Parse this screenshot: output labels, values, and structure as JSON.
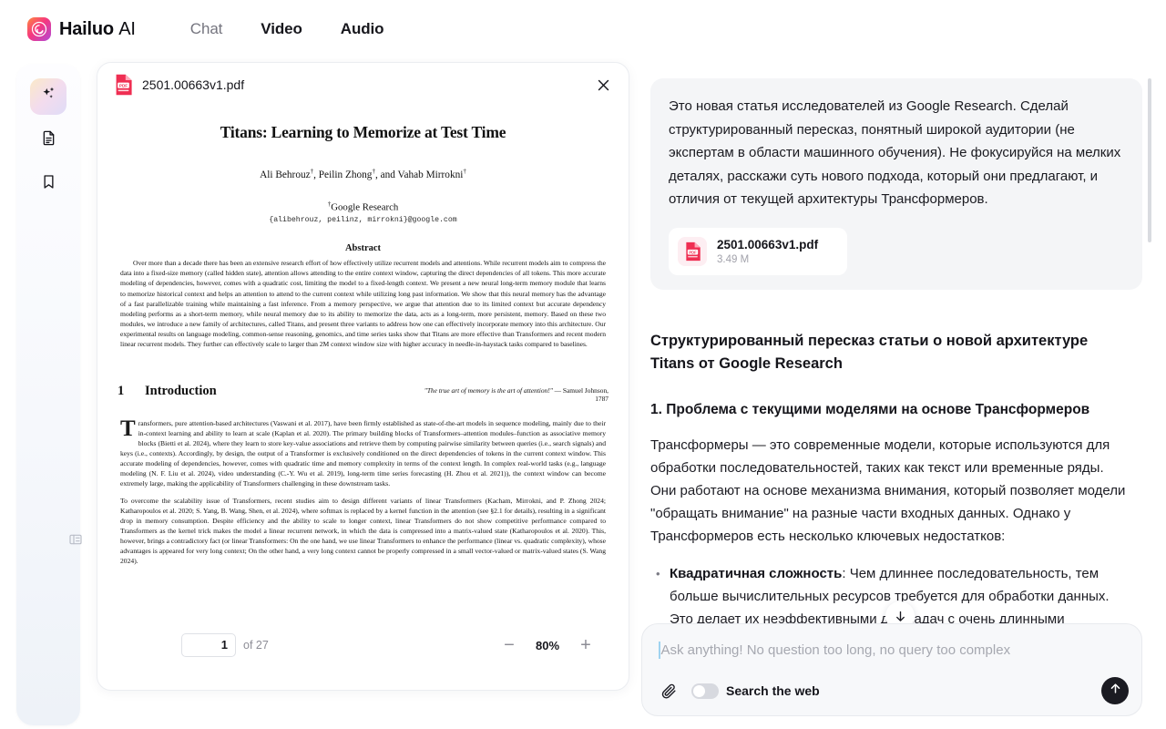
{
  "header": {
    "brand_primary": "Hailuo",
    "brand_secondary": "AI",
    "nav": [
      {
        "label": "Chat",
        "active": false
      },
      {
        "label": "Video",
        "active": true
      },
      {
        "label": "Audio",
        "active": true
      }
    ]
  },
  "rail": {
    "items": [
      {
        "icon": "sparkle-icon",
        "active": true
      },
      {
        "icon": "document-icon",
        "active": false
      },
      {
        "icon": "bookmark-icon",
        "active": false
      }
    ],
    "collapse_icon": "collapse-panel-icon"
  },
  "pdf_viewer": {
    "file_name": "2501.00663v1.pdf",
    "close_icon": "close-icon",
    "page_current": "1",
    "page_of_label": "of 27",
    "zoom_out_label": "−",
    "zoom_level": "80%",
    "zoom_in_label": "+",
    "document": {
      "title": "Titans: Learning to Memorize at Test Time",
      "authors": "Ali Behrouz†, Peilin Zhong†, and Vahab Mirrokni†",
      "affiliation": "†Google Research",
      "emails": "{alibehrouz, peilinz, mirrokni}@google.com",
      "abstract_heading": "Abstract",
      "abstract": "Over more than a decade there has been an extensive research effort of how effectively utilize recurrent models and attentions. While recurrent models aim to compress the data into a fixed-size memory (called hidden state), attention allows attending to the entire context window, capturing the direct dependencies of all tokens. This more accurate modeling of dependencies, however, comes with a quadratic cost, limiting the model to a fixed-length context. We present a new neural long-term memory module that learns to memorize historical context and helps an attention to attend to the current context while utilizing long past information. We show that this neural memory has the advantage of a fast parallelizable training while maintaining a fast inference. From a memory perspective, we argue that attention due to its limited context but accurate dependency modeling performs as a short-term memory, while neural memory due to its ability to memorize the data, acts as a long-term, more persistent, memory. Based on these two modules, we introduce a new family of architectures, called Titans, and present three variants to address how one can effectively incorporate memory into this architecture. Our experimental results on language modeling, common-sense reasoning, genomics, and time series tasks show that Titans are more effective than Transformers and recent modern linear recurrent models. They further can effectively scale to larger than 2M context window size with higher accuracy in needle-in-haystack tasks compared to baselines.",
      "section_number": "1",
      "section_title": "Introduction",
      "epigraph": "\"The true art of memory is the art of attention!\"",
      "epigraph_attribution": "— Samuel Johnson, 1787",
      "para1_dropcap": "T",
      "para1": "ransformers, pure attention-based architectures (Vaswani et al. 2017), have been firmly established as state-of-the-art models in sequence modeling, mainly due to their in-context learning and ability to learn at scale (Kaplan et al. 2020). The primary building blocks of Transformers–attention modules–function as associative memory blocks (Bietti et al. 2024), where they learn to store key-value associations and retrieve them by computing pairwise similarity between queries (i.e., search signals) and keys (i.e., contexts). Accordingly, by design, the output of a Transformer is exclusively conditioned on the direct dependencies of tokens in the current context window. This accurate modeling of dependencies, however, comes with quadratic time and memory complexity in terms of the context length. In complex real-world tasks (e.g., language modeling (N. F. Liu et al. 2024), video understanding (C.-Y. Wu et al. 2019), long-term time series forecasting (H. Zhou et al. 2021)), the context window can become extremely large, making the applicability of Transformers challenging in these downstream tasks.",
      "para2": "To overcome the scalability issue of Transformers, recent studies aim to design different variants of linear Transformers (Kacham, Mirrokni, and P. Zhong 2024; Katharopoulos et al. 2020; S. Yang, B. Wang, Shen, et al. 2024), where softmax is replaced by a kernel function in the attention (see §2.1 for details), resulting in a significant drop in memory consumption. Despite efficiency and the ability to scale to longer context, linear Transformers do not show competitive performance compared to Transformers as the kernel trick makes the model a linear recurrent network, in which the data is compressed into a matrix-valued state (Katharopoulos et al. 2020). This, however, brings a contradictory fact (or linear Transformers: On the one hand, we use linear Transformers to enhance the performance (linear vs. quadratic complexity), whose advantages is appeared for very long context; On the other hand, a very long context cannot be properly compressed in a small vector-valued or matrix-valued states (S. Wang 2024)."
    }
  },
  "chat": {
    "user_message": "Это новая статья исследователей из Google Research. Сделай структурированный пересказ, понятный широкой аудитории (не экспертам в области машинного обучения). Не фокусируйся на мелких деталях, расскажи суть нового подхода, который они предлагают, и отличия от текущей архитектуры Трансформеров.",
    "attachment": {
      "name": "2501.00663v1.pdf",
      "size": "3.49 M",
      "icon": "pdf-file-icon"
    },
    "answer": {
      "heading": "Структурированный пересказ статьи о новой архитектуре Titans от Google Research",
      "subheading": "1. Проблема с текущими моделями на основе Трансформеров",
      "paragraph": "Трансформеры — это современные модели, которые используются для обработки последовательностей, таких как текст или временные ряды. Они работают на основе механизма внимания, который позволяет модели \"обращать внимание\" на разные части входных данных. Однако у Трансформеров есть несколько ключевых недостатков:",
      "bullets": [
        {
          "bold": "Квадратичная сложность",
          "text": ": Чем длиннее последовательность, тем больше вычислительных ресурсов требуется для обработки данных. Это делает их неэффективными для задач с очень длинными последовательностями, таких как анализ длинных текстов или"
        }
      ]
    },
    "scroll_down_icon": "scroll-to-bottom-icon"
  },
  "composer": {
    "placeholder": "Ask anything! No question too long, no query too complex",
    "value": "",
    "attach_icon": "paperclip-icon",
    "web_toggle_label": "Search the web",
    "web_toggle_on": false,
    "send_icon": "send-arrow-up-icon"
  },
  "colors": {
    "accent_brand_start": "#ff8a3d",
    "accent_brand_end": "#b14bd8",
    "pdf_red": "#ef2e52",
    "send_button": "#1b1b22",
    "bubble_bg": "#f4f5f7"
  }
}
